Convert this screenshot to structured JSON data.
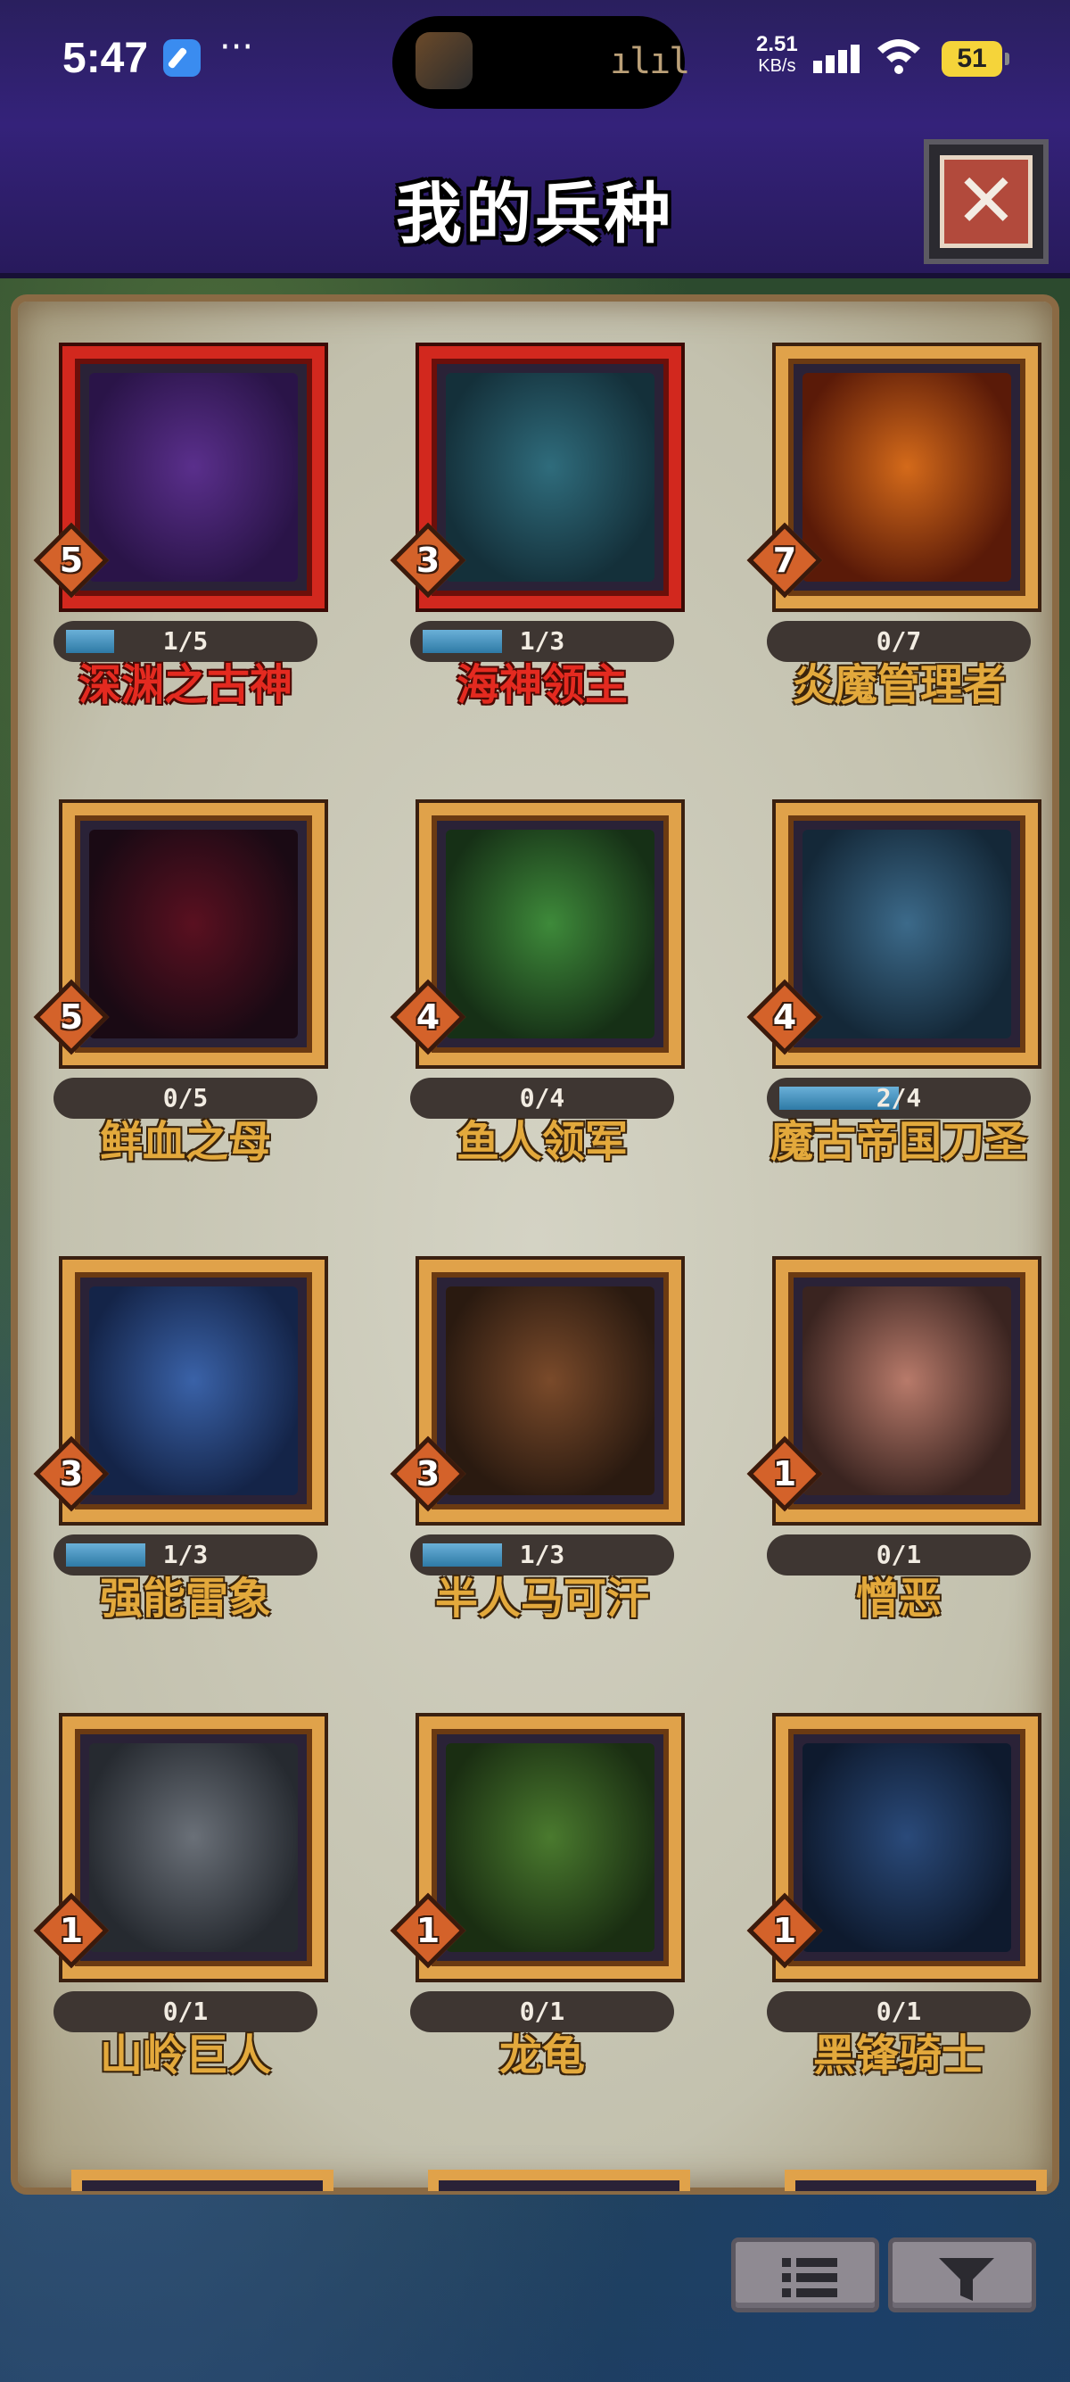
{
  "status_bar": {
    "time": "5:47",
    "more": "···",
    "net_speed": "2.51",
    "net_unit": "KB/s",
    "battery": "51"
  },
  "header": {
    "title": "我的兵种"
  },
  "units": [
    {
      "level": "5",
      "progress": "1/5",
      "name": "深渊之古神",
      "rarity": "red",
      "fill": 0.2
    },
    {
      "level": "3",
      "progress": "1/3",
      "name": "海神领主",
      "rarity": "red",
      "fill": 0.333
    },
    {
      "level": "7",
      "progress": "0/7",
      "name": "炎魔管理者",
      "rarity": "gold",
      "fill": 0
    },
    {
      "level": "5",
      "progress": "0/5",
      "name": "鲜血之母",
      "rarity": "gold",
      "fill": 0
    },
    {
      "level": "4",
      "progress": "0/4",
      "name": "鱼人领军",
      "rarity": "gold",
      "fill": 0
    },
    {
      "level": "4",
      "progress": "2/4",
      "name": "魔古帝国刀圣",
      "rarity": "gold",
      "fill": 0.5
    },
    {
      "level": "3",
      "progress": "1/3",
      "name": "强能雷象",
      "rarity": "gold",
      "fill": 0.333
    },
    {
      "level": "3",
      "progress": "1/3",
      "name": "半人马可汗",
      "rarity": "gold",
      "fill": 0.333
    },
    {
      "level": "1",
      "progress": "0/1",
      "name": "憎恶",
      "rarity": "gold",
      "fill": 0
    },
    {
      "level": "1",
      "progress": "0/1",
      "name": "山岭巨人",
      "rarity": "gold",
      "fill": 0
    },
    {
      "level": "1",
      "progress": "0/1",
      "name": "龙龟",
      "rarity": "gold",
      "fill": 0
    },
    {
      "level": "1",
      "progress": "0/1",
      "name": "黑锋骑士",
      "rarity": "gold",
      "fill": 0
    }
  ],
  "icons": {
    "close": "close-icon",
    "list": "list-icon",
    "filter": "filter-icon"
  }
}
